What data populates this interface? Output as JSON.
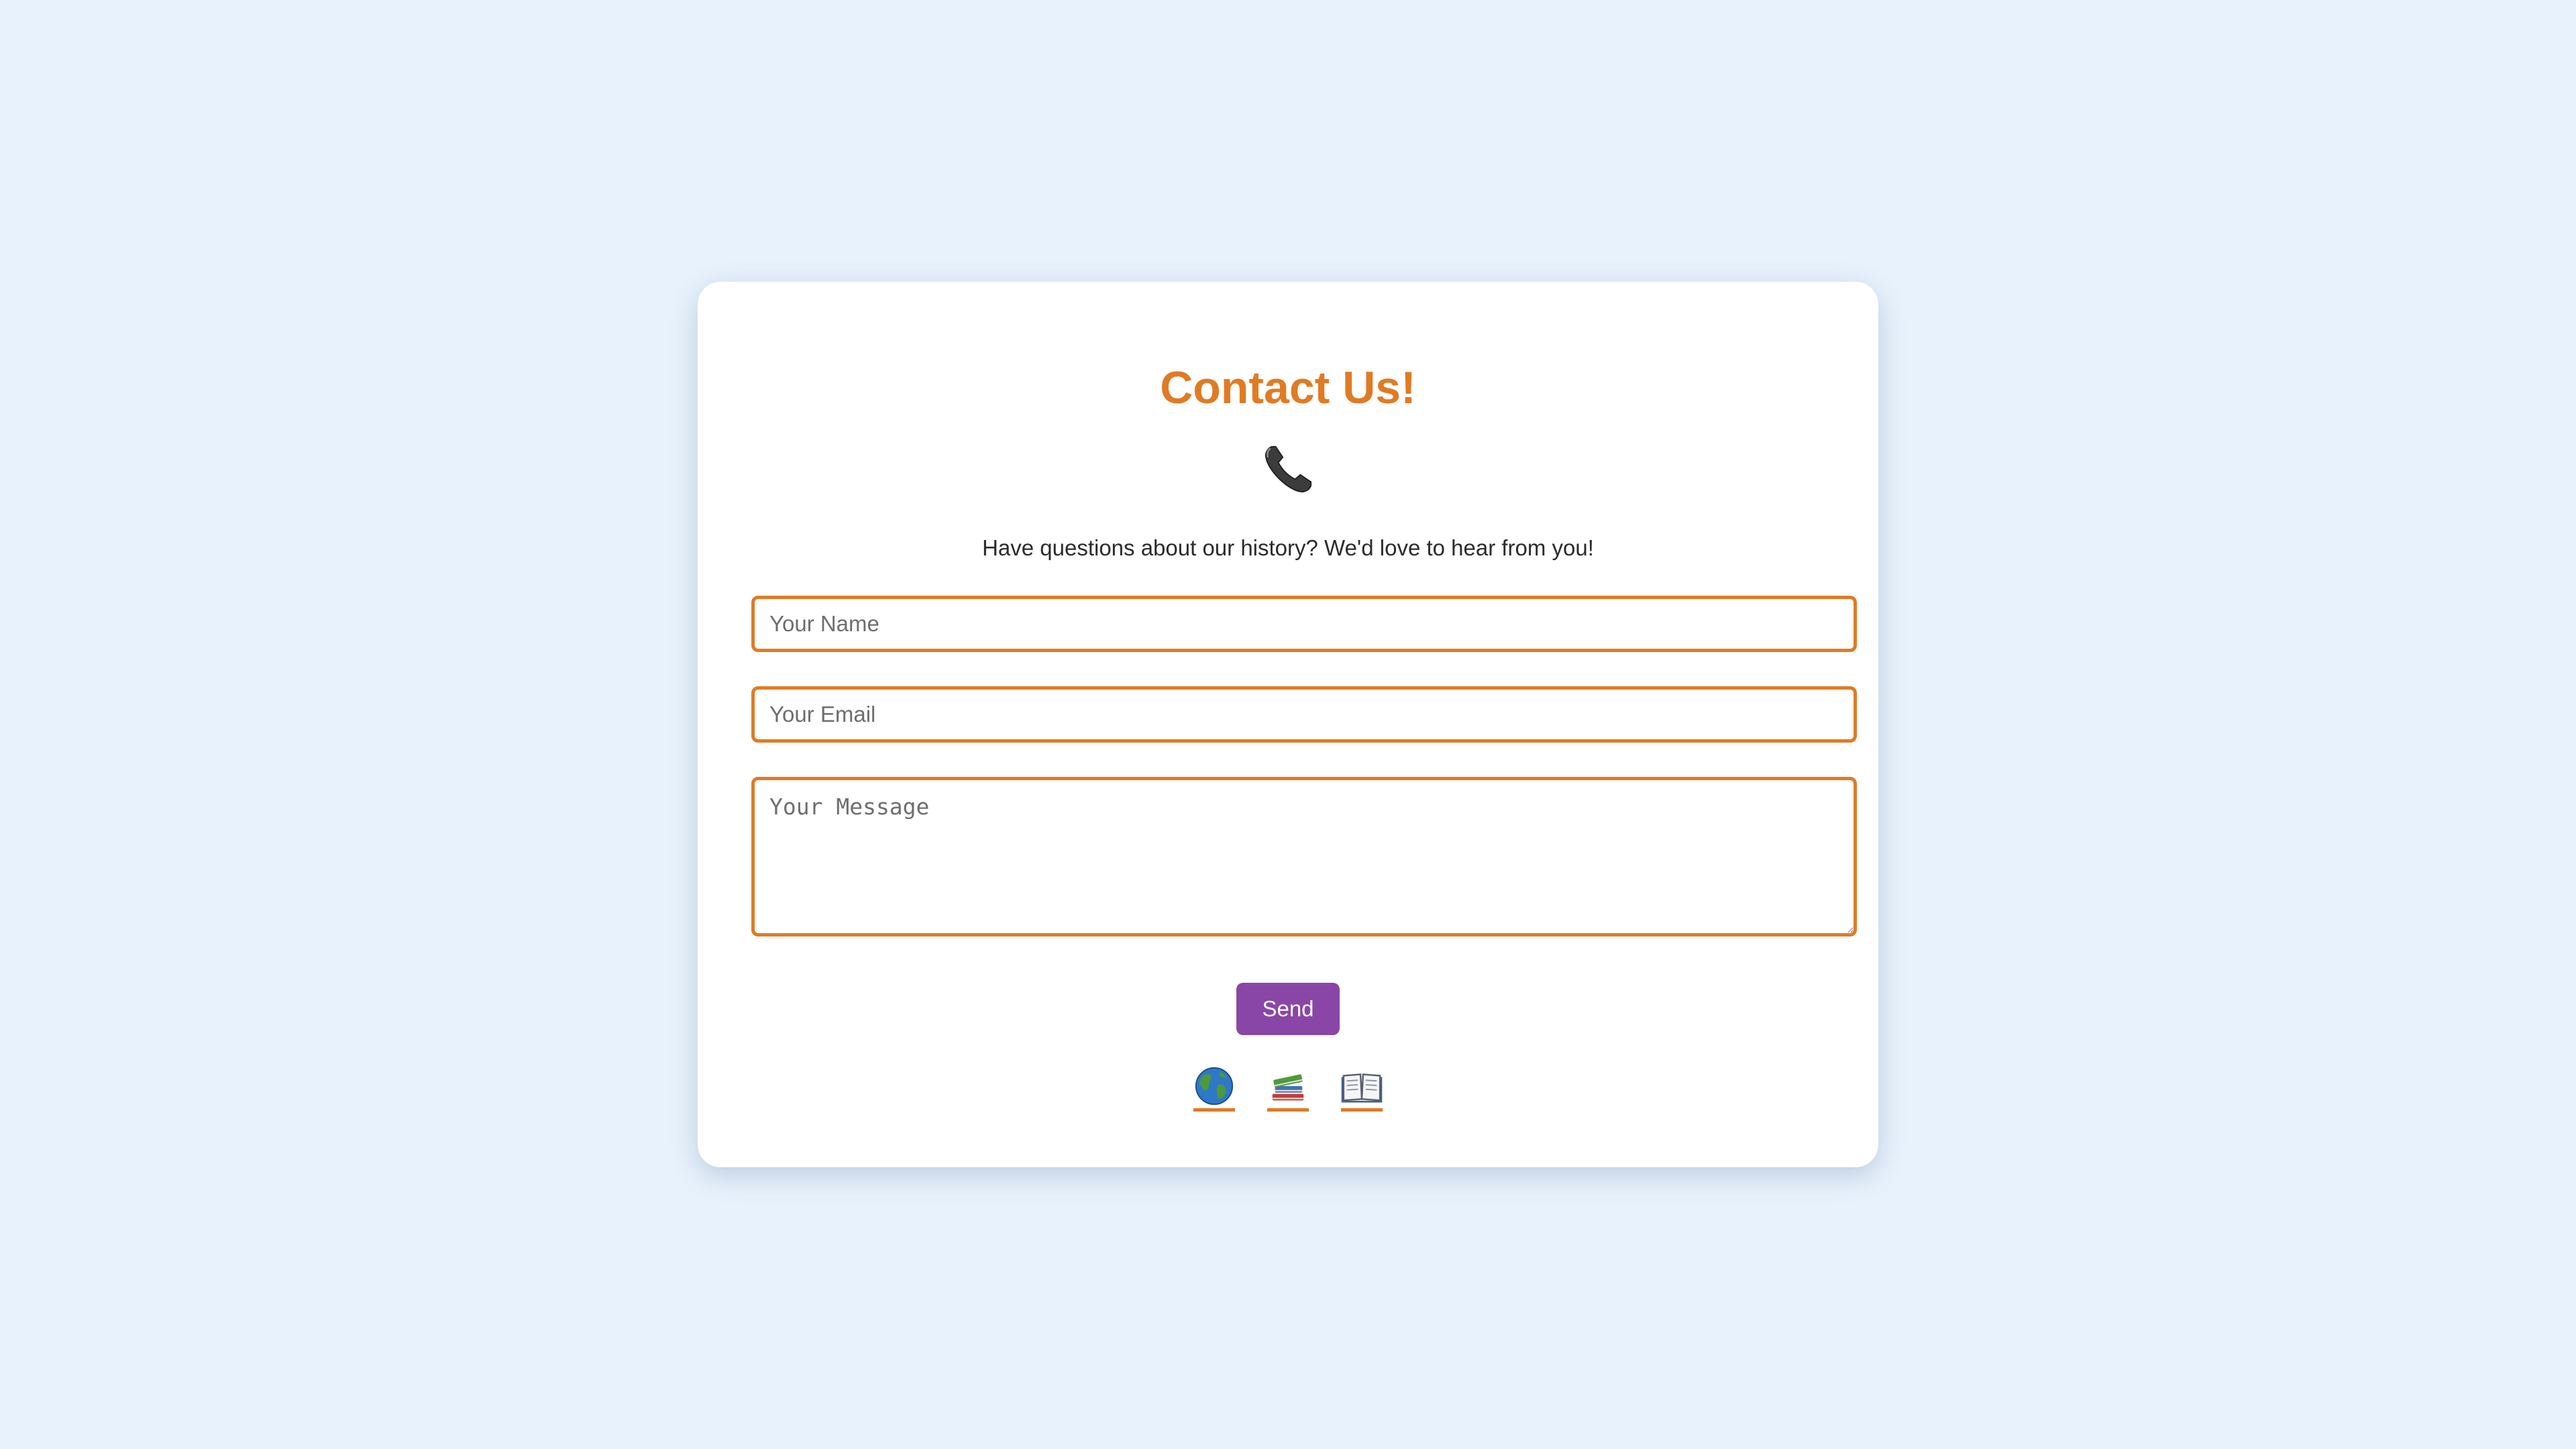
{
  "contact": {
    "title": "Contact Us!",
    "icon": "phone-icon",
    "intro": "Have questions about our history? We'd love to hear from you!",
    "form": {
      "name_placeholder": "Your Name",
      "name_value": "",
      "email_placeholder": "Your Email",
      "email_value": "",
      "message_placeholder": "Your Message",
      "message_value": "",
      "send_label": "Send"
    },
    "links": [
      {
        "icon": "globe-icon"
      },
      {
        "icon": "books-icon"
      },
      {
        "icon": "open-book-icon"
      }
    ]
  },
  "colors": {
    "background": "#e8f2fc",
    "accent": "#e07b24",
    "button": "#8a46a6",
    "card": "#ffffff"
  }
}
